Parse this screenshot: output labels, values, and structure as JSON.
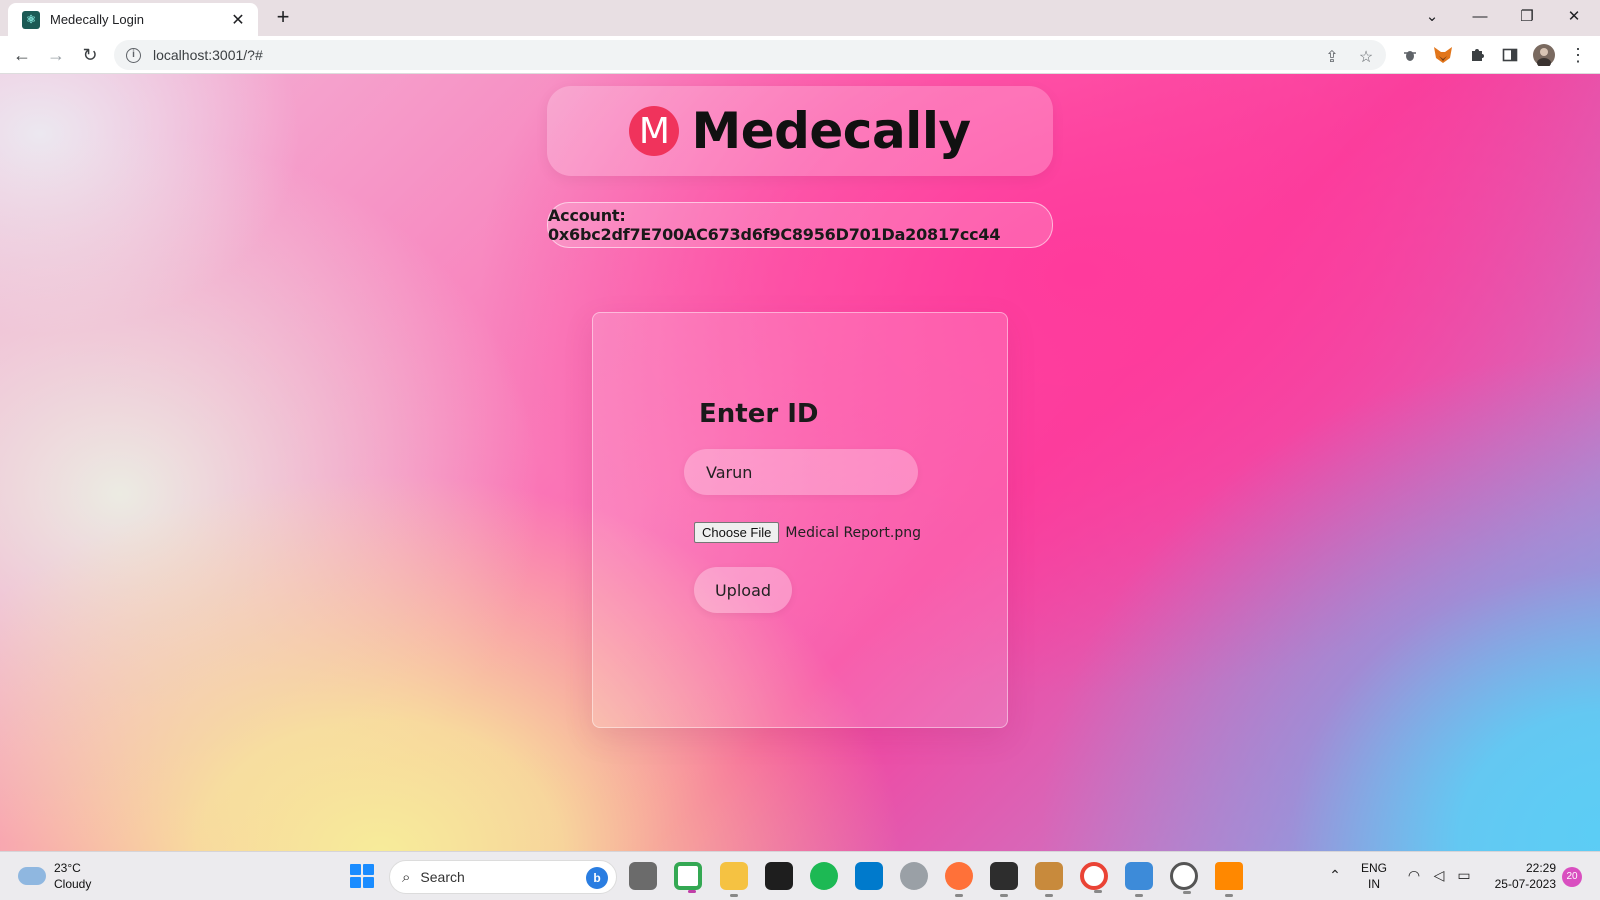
{
  "browser": {
    "tab_title": "Medecally Login",
    "tab_close": "✕",
    "new_tab": "+",
    "url": "localhost:3001/?#",
    "window_controls": {
      "tabs_menu": "⌄",
      "minimize": "—",
      "restore": "❐",
      "close": "✕"
    },
    "nav": {
      "back": "←",
      "forward": "→",
      "reload": "↻"
    },
    "icons": {
      "share": "⇪",
      "bookmark": "☆",
      "menu": "⋮"
    }
  },
  "page": {
    "logo_letter": "M",
    "brand_name": "Medecally",
    "account_label": "Account: 0x6bc2df7E700AC673d6f9C8956D701Da20817cc44",
    "card_title": "Enter ID",
    "id_input_value": "Varun",
    "choose_file_label": "Choose File",
    "file_name": "Medical Report.png",
    "upload_button": "Upload"
  },
  "taskbar": {
    "temperature": "23°C",
    "weather": "Cloudy",
    "search_label": "Search",
    "language_line1": "ENG",
    "language_line2": "IN",
    "time": "22:29",
    "date": "25-07-2023",
    "notification_count": "20"
  },
  "colors": {
    "logo_mark": "#f0335c",
    "windows_blue": "#1a8cff",
    "spotify_green": "#1db954",
    "vscode_blue": "#007acc"
  }
}
